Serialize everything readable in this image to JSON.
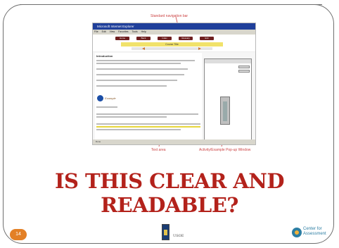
{
  "annotations": {
    "top": "Standard navigation bar",
    "left": "Text area",
    "right": "Activity/Example Pop-up Window"
  },
  "screenshot": {
    "titlebar_text": "Microsoft Internet Explorer",
    "menu": [
      "File",
      "Edit",
      "View",
      "Favorites",
      "Tools",
      "Help"
    ],
    "nav_buttons": [
      "Home",
      "Back",
      "Index",
      "Glossary",
      "Exit"
    ],
    "banner_text": "Course Title",
    "content_heading": "Introduction",
    "sample_label": "Example",
    "statusbar_text": "Done"
  },
  "slide": {
    "question": "IS THIS CLEAR AND READABLE?",
    "page_number": "14",
    "footer_logo_text": "USOE",
    "cfa_line1": "Center for",
    "cfa_line2": "Assessment"
  }
}
